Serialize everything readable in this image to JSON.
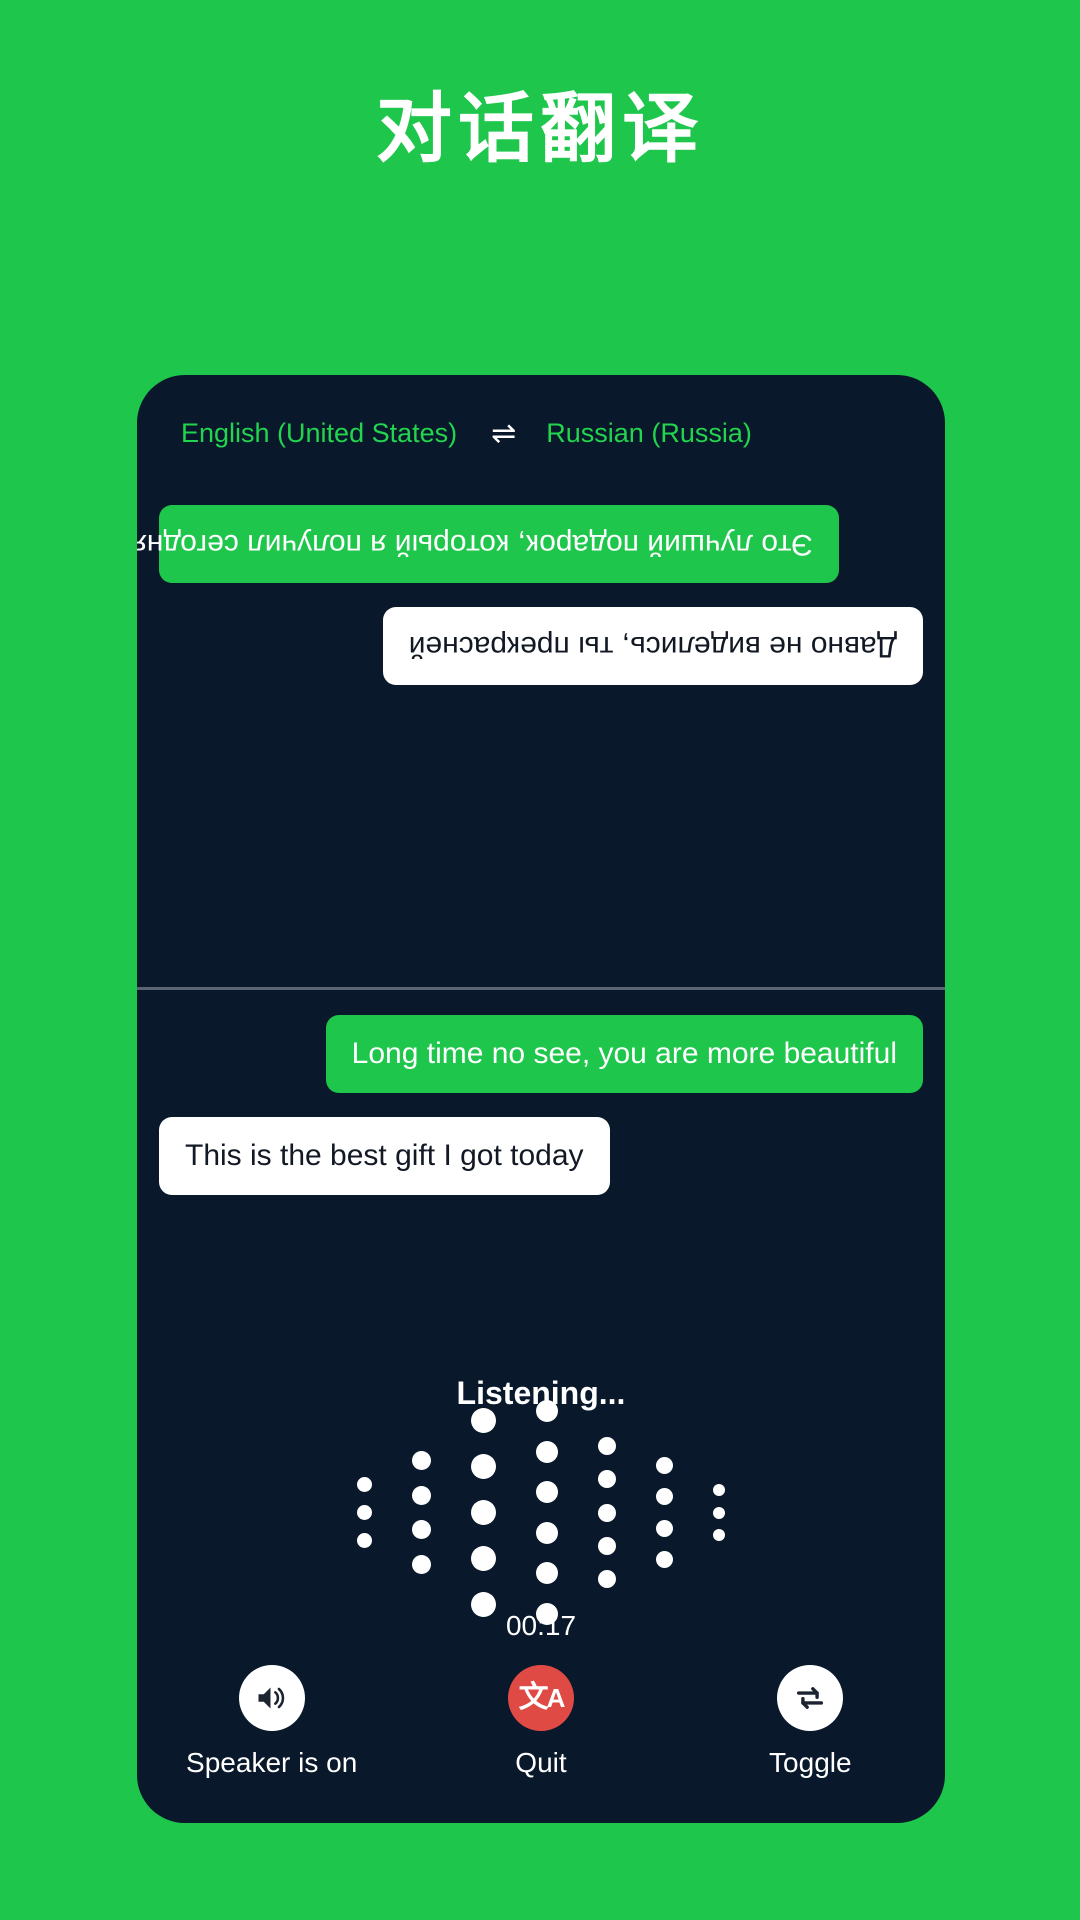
{
  "page": {
    "title": "对话翻译",
    "background_color": "#1ec64b",
    "card_color": "#09182a"
  },
  "languages": {
    "source": "English (United States)",
    "target": "Russian (Russia)",
    "swap_icon": "swap-arrows-icon",
    "swap_glyph": "⇌",
    "text_color": "#22d44e"
  },
  "conversation": {
    "remote_messages": [
      {
        "text": "Это лучший подарок, который я получил сегодня",
        "style": "green"
      },
      {
        "text": "Давно не виделись, ты прекрасней",
        "style": "white"
      }
    ],
    "local_messages": [
      {
        "text": "Long time no see, you are more beautiful",
        "style": "green"
      },
      {
        "text": "This is the best gift I got today",
        "style": "white"
      }
    ]
  },
  "status": {
    "listening_label": "Listening...",
    "timer": "00:17"
  },
  "waveform": {
    "columns": [
      {
        "dots": 3,
        "size": 15
      },
      {
        "dots": 4,
        "size": 19
      },
      {
        "dots": 5,
        "size": 25
      },
      {
        "dots": 6,
        "size": 22
      },
      {
        "dots": 5,
        "size": 18
      },
      {
        "dots": 4,
        "size": 17
      },
      {
        "dots": 3,
        "size": 12
      }
    ],
    "dot_color": "#ffffff"
  },
  "controls": [
    {
      "label": "Speaker is on",
      "icon": "speaker-on-icon",
      "circle_color": "#ffffff"
    },
    {
      "label": "Quit",
      "icon": "translate-icon",
      "circle_color": "#e04a45"
    },
    {
      "label": "Toggle",
      "icon": "repeat-swap-icon",
      "circle_color": "#ffffff"
    }
  ]
}
